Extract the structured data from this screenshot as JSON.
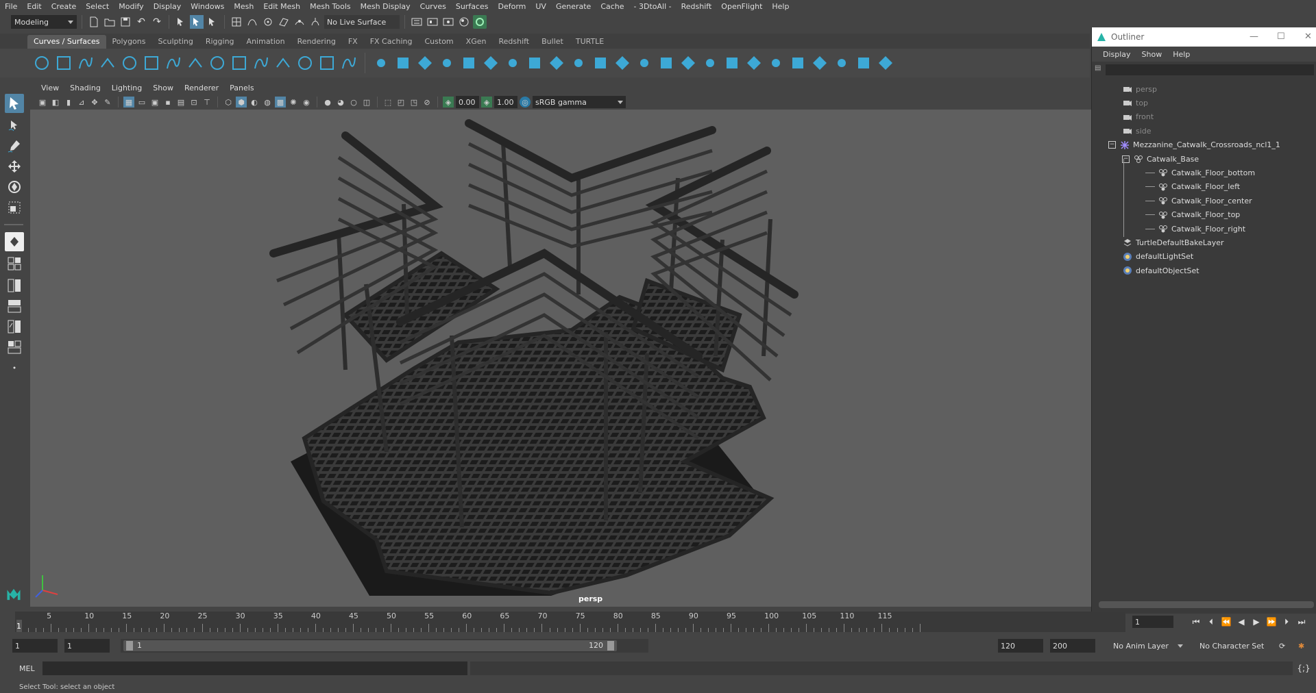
{
  "menubar": [
    "File",
    "Edit",
    "Create",
    "Select",
    "Modify",
    "Display",
    "Windows",
    "Mesh",
    "Edit Mesh",
    "Mesh Tools",
    "Mesh Display",
    "Curves",
    "Surfaces",
    "Deform",
    "UV",
    "Generate",
    "Cache",
    "- 3DtoAll -",
    "Redshift",
    "OpenFlight",
    "Help"
  ],
  "statusline": {
    "mode": "Modeling",
    "live_surface": "No Live Surface"
  },
  "shelf_tabs": [
    "Curves / Surfaces",
    "Polygons",
    "Sculpting",
    "Rigging",
    "Animation",
    "Rendering",
    "FX",
    "FX Caching",
    "Custom",
    "XGen",
    "Redshift",
    "Bullet",
    "TURTLE"
  ],
  "active_shelf_tab": "Curves / Surfaces",
  "viewport": {
    "menu": [
      "View",
      "Shading",
      "Lighting",
      "Show",
      "Renderer",
      "Panels"
    ],
    "exposure": "0.00",
    "gamma": "1.00",
    "color_space": "sRGB gamma",
    "camera": "persp"
  },
  "outliner": {
    "title": "Outliner",
    "menu": [
      "Display",
      "Show",
      "Help"
    ],
    "items": [
      {
        "label": "persp",
        "depth": 0,
        "icon": "camera-icon",
        "dim": true
      },
      {
        "label": "top",
        "depth": 0,
        "icon": "camera-icon",
        "dim": true
      },
      {
        "label": "front",
        "depth": 0,
        "icon": "camera-icon",
        "dim": true
      },
      {
        "label": "side",
        "depth": 0,
        "icon": "camera-icon",
        "dim": true
      },
      {
        "label": "Mezzanine_Catwalk_Crossroads_ncl1_1",
        "depth": 0,
        "icon": "joint-icon",
        "expander": "−"
      },
      {
        "label": "Catwalk_Base",
        "depth": 1,
        "icon": "group-icon",
        "expander": "−"
      },
      {
        "label": "Catwalk_Floor_bottom",
        "depth": 2,
        "icon": "mesh-icon"
      },
      {
        "label": "Catwalk_Floor_left",
        "depth": 2,
        "icon": "mesh-icon"
      },
      {
        "label": "Catwalk_Floor_center",
        "depth": 2,
        "icon": "mesh-icon"
      },
      {
        "label": "Catwalk_Floor_top",
        "depth": 2,
        "icon": "mesh-icon"
      },
      {
        "label": "Catwalk_Floor_right",
        "depth": 2,
        "icon": "mesh-icon"
      },
      {
        "label": "TurtleDefaultBakeLayer",
        "depth": 0,
        "icon": "layer-icon"
      },
      {
        "label": "defaultLightSet",
        "depth": 0,
        "icon": "set-icon"
      },
      {
        "label": "defaultObjectSet",
        "depth": 0,
        "icon": "set-icon"
      }
    ]
  },
  "timeslider": {
    "ticks": [
      1,
      5,
      10,
      15,
      20,
      25,
      30,
      35,
      40,
      45,
      50,
      55,
      60,
      65,
      70,
      75,
      80,
      85,
      90,
      95,
      100,
      105,
      110,
      115
    ],
    "current_frame": "1"
  },
  "range": {
    "start": "1",
    "playback_start": "1",
    "range_start_label": "1",
    "range_end_label": "120",
    "playback_end": "120",
    "end": "200",
    "anim_layer": "No Anim Layer",
    "character_set": "No Character Set"
  },
  "cmdline": {
    "label": "MEL"
  },
  "helpline": "Select Tool: select an object",
  "colors": {
    "accent": "#5285a6",
    "shelf_icon": "#3da9d6",
    "viewport_bg": "#5f5f5f"
  }
}
